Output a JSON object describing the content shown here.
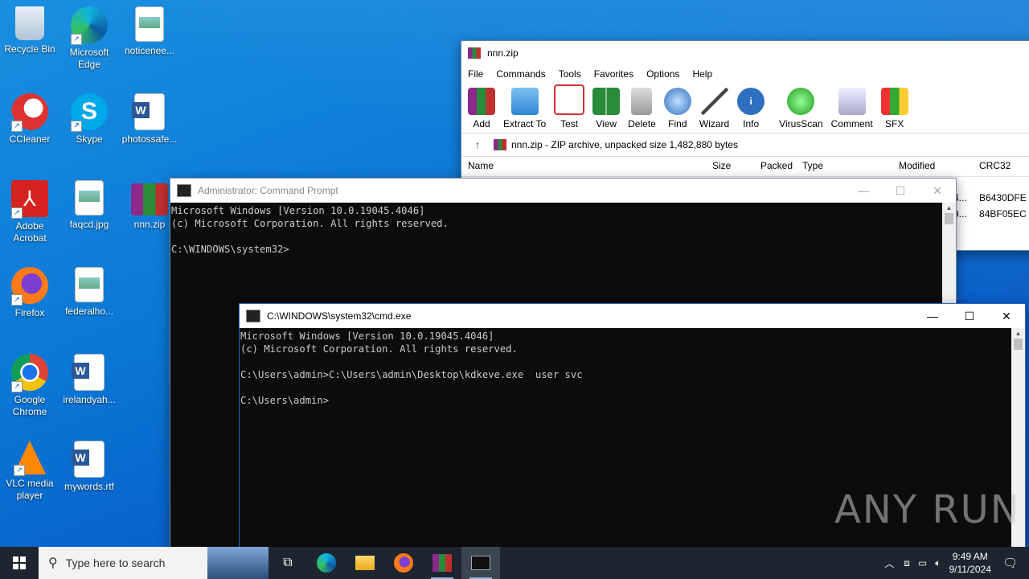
{
  "desktop": {
    "icons": [
      {
        "label": "Recycle Bin"
      },
      {
        "label": "Microsoft Edge"
      },
      {
        "label": "noticenee..."
      },
      {
        "label": "CCleaner"
      },
      {
        "label": "Skype"
      },
      {
        "label": "photossafe..."
      },
      {
        "label": "Adobe Acrobat"
      },
      {
        "label": "faqcd.jpg"
      },
      {
        "label": "nnn.zip"
      },
      {
        "label": "Firefox"
      },
      {
        "label": "federalho..."
      },
      {
        "label": "Google Chrome"
      },
      {
        "label": "irelandyah..."
      },
      {
        "label": "VLC media player"
      },
      {
        "label": "mywords.rtf"
      }
    ]
  },
  "winrar": {
    "title": "nnn.zip",
    "menu": [
      "File",
      "Commands",
      "Tools",
      "Favorites",
      "Options",
      "Help"
    ],
    "toolbar": [
      "Add",
      "Extract To",
      "Test",
      "View",
      "Delete",
      "Find",
      "Wizard",
      "Info",
      "VirusScan",
      "Comment",
      "SFX"
    ],
    "path": "nnn.zip - ZIP archive, unpacked size 1,482,880 bytes",
    "columns": [
      "Name",
      "Size",
      "Packed",
      "Type",
      "Modified",
      "CRC32"
    ],
    "rows": [
      {
        "modified_partial": "4...",
        "crc": "B6430DFE"
      },
      {
        "modified_partial": "9...",
        "crc": "84BF05EC"
      }
    ]
  },
  "admin_cmd": {
    "title": "Administrator: Command Prompt",
    "lines": "Microsoft Windows [Version 10.0.19045.4046]\n(c) Microsoft Corporation. All rights reserved.\n\nC:\\WINDOWS\\system32>"
  },
  "cmd": {
    "title": "C:\\WINDOWS\\system32\\cmd.exe",
    "lines": "Microsoft Windows [Version 10.0.19045.4046]\n(c) Microsoft Corporation. All rights reserved.\n\nC:\\Users\\admin>C:\\Users\\admin\\Desktop\\kdkeve.exe  user svc\n\nC:\\Users\\admin>"
  },
  "watermark": "ANY RUN",
  "taskbar": {
    "search_placeholder": "Type here to search",
    "time": "9:49 AM",
    "date": "9/11/2024"
  }
}
